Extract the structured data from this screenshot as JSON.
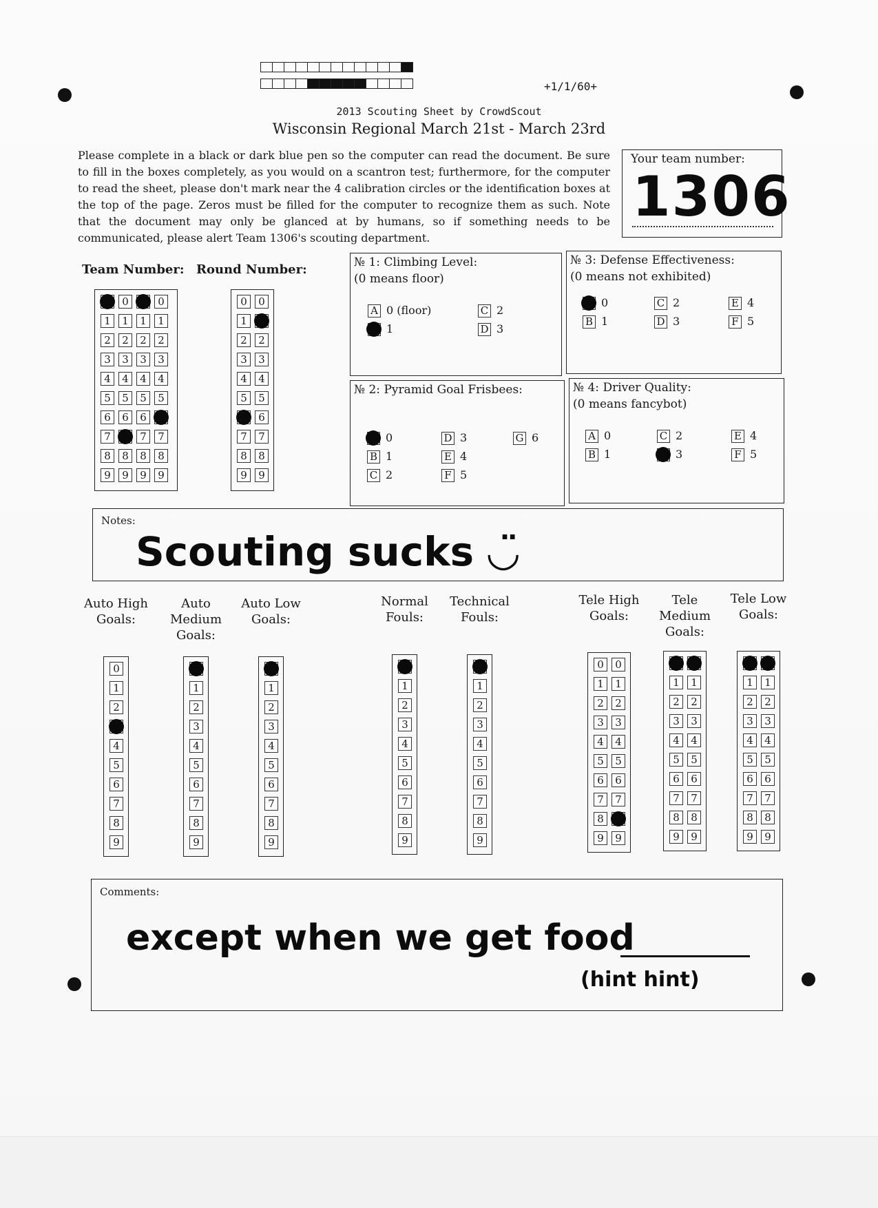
{
  "header": {
    "code": "+1/1/60+",
    "line1": "2013 Scouting Sheet by CrowdScout",
    "line2": "Wisconsin Regional March 21st - March 23rd"
  },
  "instructions": "Please complete in a black or dark blue pen so the computer can read the document. Be sure to fill in the boxes completely, as you would on a scantron test; furthermore, for the computer to read the sheet, please don't mark near the 4 calibration circles or the identification boxes at the top of the page. Zeros must be filled for the computer to recognize them as such. Note that the document may only be glanced at by humans, so if something needs to be communicated, please alert Team 1306's scouting department.",
  "team_box": {
    "label": "Your team number:",
    "value": "1306"
  },
  "team_number": {
    "label": "Team Number:",
    "columns": 4,
    "digits": [
      "0",
      "1",
      "2",
      "3",
      "4",
      "5",
      "6",
      "7",
      "8",
      "9"
    ],
    "marked": [
      0,
      7,
      0,
      6
    ]
  },
  "round_number": {
    "label": "Round Number:",
    "columns": 2,
    "digits": [
      "0",
      "1",
      "2",
      "3",
      "4",
      "5",
      "6",
      "7",
      "8",
      "9"
    ],
    "marked": [
      6,
      1
    ]
  },
  "questions": [
    {
      "title": "№ 1: Climbing Level:",
      "subtitle": "(0 means floor)",
      "options": [
        {
          "letter": "A",
          "text": "0 (floor)"
        },
        {
          "letter": "C",
          "text": "2"
        },
        {
          "letter": "B",
          "text": "1"
        },
        {
          "letter": "D",
          "text": "3"
        }
      ],
      "marked": "B"
    },
    {
      "title": "№ 3: Defense Effectiveness:",
      "subtitle": "(0 means not exhibited)",
      "options": [
        {
          "letter": "A",
          "text": "0"
        },
        {
          "letter": "C",
          "text": "2"
        },
        {
          "letter": "E",
          "text": "4"
        },
        {
          "letter": "B",
          "text": "1"
        },
        {
          "letter": "D",
          "text": "3"
        },
        {
          "letter": "F",
          "text": "5"
        }
      ],
      "marked": "A"
    },
    {
      "title": "№ 2: Pyramid Goal Frisbees:",
      "subtitle": "",
      "options": [
        {
          "letter": "A",
          "text": "0"
        },
        {
          "letter": "D",
          "text": "3"
        },
        {
          "letter": "G",
          "text": "6"
        },
        {
          "letter": "B",
          "text": "1"
        },
        {
          "letter": "E",
          "text": "4"
        },
        {
          "letter": "C",
          "text": "2"
        },
        {
          "letter": "F",
          "text": "5"
        }
      ],
      "marked": "A"
    },
    {
      "title": "№ 4: Driver Quality:",
      "subtitle": "(0 means fancybot)",
      "options": [
        {
          "letter": "A",
          "text": "0"
        },
        {
          "letter": "C",
          "text": "2"
        },
        {
          "letter": "E",
          "text": "4"
        },
        {
          "letter": "B",
          "text": "1"
        },
        {
          "letter": "D",
          "text": "3"
        },
        {
          "letter": "F",
          "text": "5"
        }
      ],
      "marked": "D"
    }
  ],
  "notes": {
    "label": "Notes:",
    "handwriting": "Scouting sucks ◡̈"
  },
  "scores": [
    {
      "label": "Auto High Goals:",
      "columns": 1,
      "marked": [
        3
      ]
    },
    {
      "label": "Auto Medium Goals:",
      "columns": 1,
      "marked": [
        0
      ]
    },
    {
      "label": "Auto Low Goals:",
      "columns": 1,
      "marked": [
        0
      ]
    },
    {
      "label": "Normal Fouls:",
      "columns": 1,
      "marked": [
        0
      ]
    },
    {
      "label": "Technical Fouls:",
      "columns": 1,
      "marked": [
        0
      ]
    },
    {
      "label": "Tele High Goals:",
      "columns": 2,
      "marked": [
        null,
        8
      ]
    },
    {
      "label": "Tele Medium Goals:",
      "columns": 2,
      "marked": [
        0,
        0
      ]
    },
    {
      "label": "Tele Low Goals:",
      "columns": 2,
      "marked": [
        0,
        0
      ]
    }
  ],
  "comments": {
    "label": "Comments:",
    "handwriting": "except when we get food",
    "aside": "(hint hint)"
  },
  "colors": {
    "ink": "#0a0a0a",
    "paper": "#f9f9f9",
    "line": "#222222"
  }
}
